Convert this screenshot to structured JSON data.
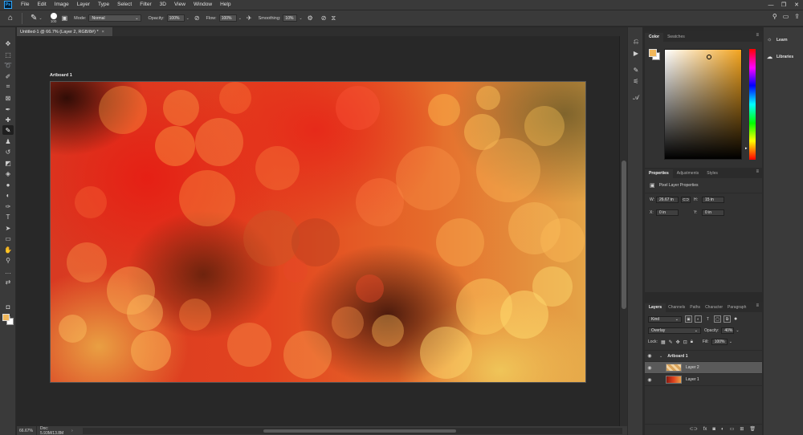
{
  "app": {
    "logo_text": "Ps",
    "menu": [
      "File",
      "Edit",
      "Image",
      "Layer",
      "Type",
      "Select",
      "Filter",
      "3D",
      "View",
      "Window",
      "Help"
    ],
    "window_controls": [
      "—",
      "❐",
      "✕"
    ]
  },
  "options_bar": {
    "brush_size": "100",
    "mode_label": "Mode:",
    "mode_value": "Normal",
    "opacity_label": "Opacity:",
    "opacity_value": "100%",
    "flow_label": "Flow:",
    "flow_value": "100%",
    "smoothing_label": "Smoothing:",
    "smoothing_value": "10%"
  },
  "document": {
    "tab_title": "Untitled-1 @ 66.7% (Layer 2, RGB/8#) *",
    "artboard_label": "Artboard 1"
  },
  "status": {
    "zoom": "66.67%",
    "doc_info": "Doc: 5.93M/13.8M"
  },
  "color_panel": {
    "tabs": [
      "Color",
      "Swatches"
    ],
    "foreground_color": "#f1b75a",
    "background_color": "#ffffff"
  },
  "properties_panel": {
    "tabs": [
      "Properties",
      "Adjustments",
      "Styles"
    ],
    "subtitle": "Pixel Layer Properties",
    "w_label": "W:",
    "w_value": "26.67 in",
    "h_label": "H:",
    "h_value": "15 in",
    "x_label": "X:",
    "x_value": "0 in",
    "y_label": "Y:",
    "y_value": "0 in"
  },
  "layers_panel": {
    "tabs": [
      "Layers",
      "Channels",
      "Paths",
      "Character",
      "Paragraph"
    ],
    "filter_kind": "Kind",
    "blend_mode": "Overlay",
    "opacity_label": "Opacity:",
    "opacity_value": "40%",
    "lock_label": "Lock:",
    "fill_label": "Fill:",
    "fill_value": "100%",
    "layers": [
      {
        "name": "Artboard 1",
        "type": "artboard"
      },
      {
        "name": "Layer 2",
        "type": "pixel",
        "selected": true
      },
      {
        "name": "Layer 1",
        "type": "pixel"
      }
    ]
  },
  "learn_panel": {
    "items": [
      "Learn",
      "Libraries"
    ]
  }
}
